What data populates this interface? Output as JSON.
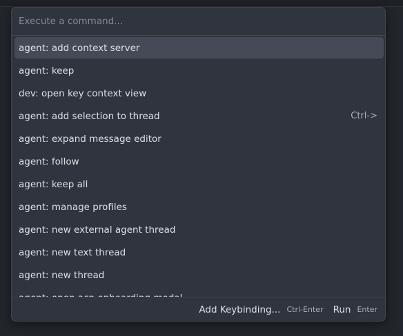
{
  "search": {
    "placeholder": "Execute a command...",
    "value": ""
  },
  "commands": [
    {
      "label": "agent: add context server",
      "shortcut": "",
      "selected": true
    },
    {
      "label": "agent: keep",
      "shortcut": ""
    },
    {
      "label": "dev: open key context view",
      "shortcut": ""
    },
    {
      "label": "agent: add selection to thread",
      "shortcut": "Ctrl->"
    },
    {
      "label": "agent: expand message editor",
      "shortcut": ""
    },
    {
      "label": "agent: follow",
      "shortcut": ""
    },
    {
      "label": "agent: keep all",
      "shortcut": ""
    },
    {
      "label": "agent: manage profiles",
      "shortcut": ""
    },
    {
      "label": "agent: new external agent thread",
      "shortcut": ""
    },
    {
      "label": "agent: new text thread",
      "shortcut": ""
    },
    {
      "label": "agent: new thread",
      "shortcut": ""
    },
    {
      "label": "agent: open acp onboarding modal",
      "shortcut": ""
    }
  ],
  "footer": {
    "add_keybinding_label": "Add Keybinding...",
    "add_keybinding_key": "Ctrl-Enter",
    "run_label": "Run",
    "run_key": "Enter"
  },
  "colors": {
    "background": "#22252b",
    "panel": "#2f343e",
    "selected": "#454a56",
    "text": "#dce0e5",
    "muted": "#a9afbc"
  }
}
